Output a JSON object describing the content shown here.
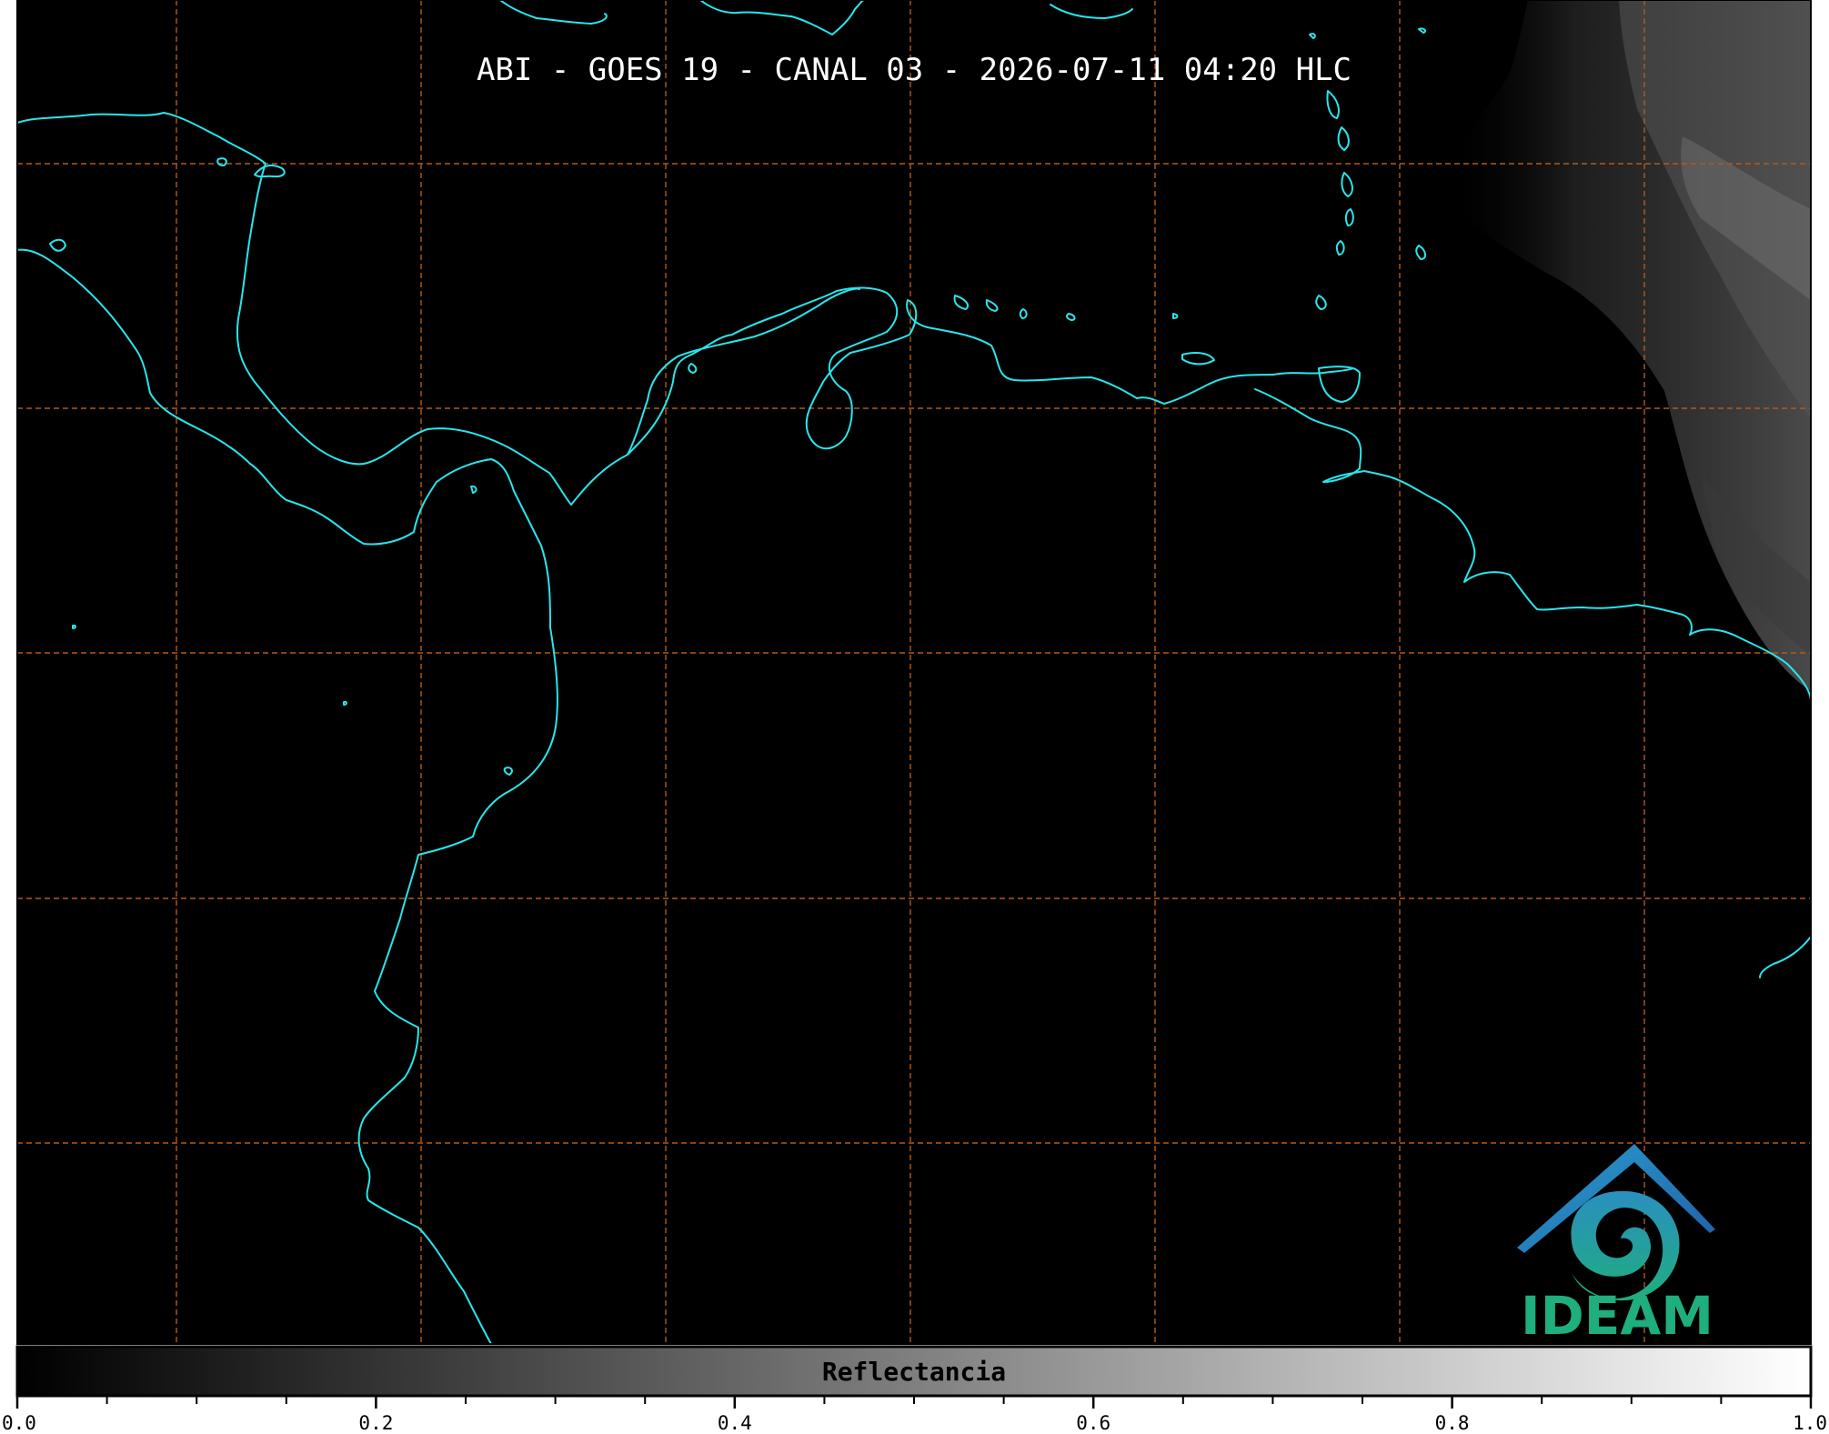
{
  "title": "ABI - GOES 19 - CANAL 03 - 2026-07-11 04:20 HLC",
  "colorbar": {
    "label": "Reflectancia",
    "ticks": [
      "0.0",
      "0.2",
      "0.4",
      "0.6",
      "0.8",
      "1.0"
    ],
    "range": [
      0.0,
      1.0
    ],
    "colormap": "gray (black to white)"
  },
  "logo": {
    "text": "IDEAM",
    "color": "#1fae7d",
    "roof_color": "#1f7fb8"
  },
  "colors": {
    "background": "#000000",
    "coastline": "#28e6ec",
    "gridlines": "#b35a18",
    "cloud_region": "#5a5a5a"
  }
}
